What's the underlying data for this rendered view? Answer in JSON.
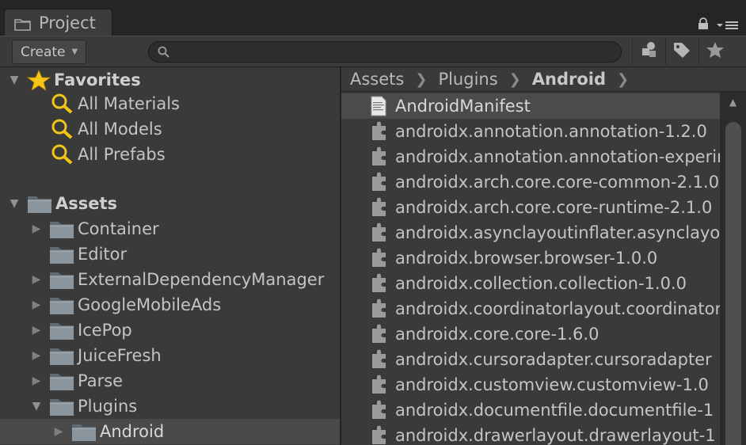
{
  "window": {
    "tab_title": "Project"
  },
  "toolbar": {
    "create_label": "Create",
    "search_value": ""
  },
  "favorites": {
    "header": "Favorites",
    "items": [
      "All Materials",
      "All Models",
      "All Prefabs"
    ]
  },
  "assets": {
    "header": "Assets",
    "items": [
      "Container",
      "Editor",
      "ExternalDependencyManager",
      "GoogleMobileAds",
      "IcePop",
      "JuiceFresh",
      "Parse",
      "Plugins",
      "Android"
    ]
  },
  "breadcrumb": {
    "items": [
      "Assets",
      "Plugins",
      "Android"
    ]
  },
  "files": [
    "AndroidManifest",
    "androidx.annotation.annotation-1.2.0",
    "androidx.annotation.annotation-experimental",
    "androidx.arch.core.core-common-2.1.0",
    "androidx.arch.core.core-runtime-2.1.0",
    "androidx.asynclayoutinflater.asynclayoutinflater",
    "androidx.browser.browser-1.0.0",
    "androidx.collection.collection-1.0.0",
    "androidx.coordinatorlayout.coordinatorlayout",
    "androidx.core.core-1.6.0",
    "androidx.cursoradapter.cursoradapter",
    "androidx.customview.customview-1.0",
    "androidx.documentfile.documentfile-1",
    "androidx.drawerlayout.drawerlayout-1"
  ],
  "colors": {
    "favorite_star": "#f5c518",
    "search_glass": "#f0c419",
    "folder": "#7d8a94"
  }
}
